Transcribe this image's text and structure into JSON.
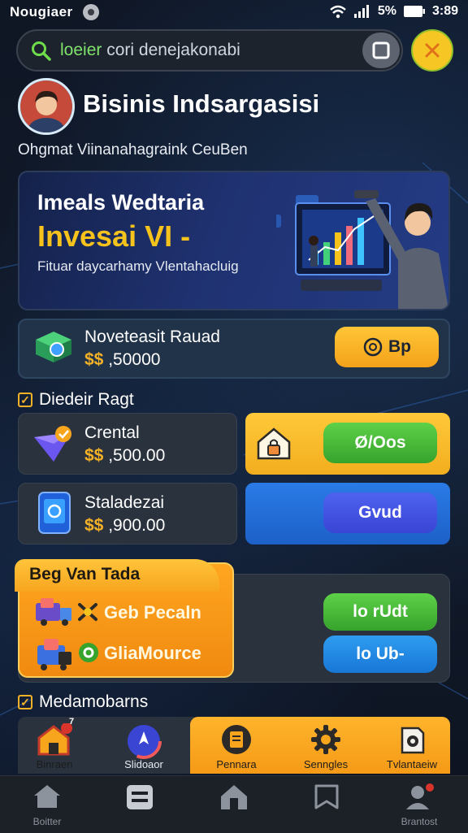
{
  "status_bar": {
    "carrier": "Nougiaer",
    "battery": "5%",
    "time": "3:89"
  },
  "search": {
    "query_prefix": "loeier",
    "query": "cori denejakonabi"
  },
  "profile": {
    "title": "Bisinis Indsargasisi",
    "subtitle": "Ohgmat Viinanahagraink CeuBen"
  },
  "hero": {
    "line1": "Imeals Wedtaria",
    "line2": "Invesai VI -",
    "line3": "Fituar daycarhamy Vlentahacluig"
  },
  "invest": {
    "name": "Noveteasit Rauad",
    "currency": "$$",
    "amount": ",50000",
    "button": "Bp"
  },
  "section1": {
    "label": "Diedeir Ragt"
  },
  "products": [
    {
      "name": "Crental",
      "currency": "$$",
      "amount": ",500.00",
      "button": "Ø/Oos"
    },
    {
      "name": "Staladezai",
      "currency": "$$",
      "amount": ",900.00",
      "button": "Gvud"
    }
  ],
  "offer": {
    "title": "Beg Van Tada",
    "items": [
      {
        "label": "Geb Pecaln",
        "button": "lo rUdt"
      },
      {
        "label": "GliaMource",
        "button": "lo Ub-"
      }
    ]
  },
  "section2": {
    "label": "Medamobarns"
  },
  "features": [
    {
      "label": "Binraen",
      "badge": "7"
    },
    {
      "label": "Slidoaor"
    },
    {
      "label": "Pennara"
    },
    {
      "label": "Senngles"
    },
    {
      "label": "Tvlantaeiw"
    }
  ],
  "nav": [
    {
      "label": "Boitter"
    },
    {
      "label": ""
    },
    {
      "label": ""
    },
    {
      "label": ""
    },
    {
      "label": "Brantost"
    }
  ],
  "colors": {
    "accent": "#f6b227",
    "green": "#43b635",
    "blue": "#3a45d4",
    "bg": "#0e1522"
  }
}
